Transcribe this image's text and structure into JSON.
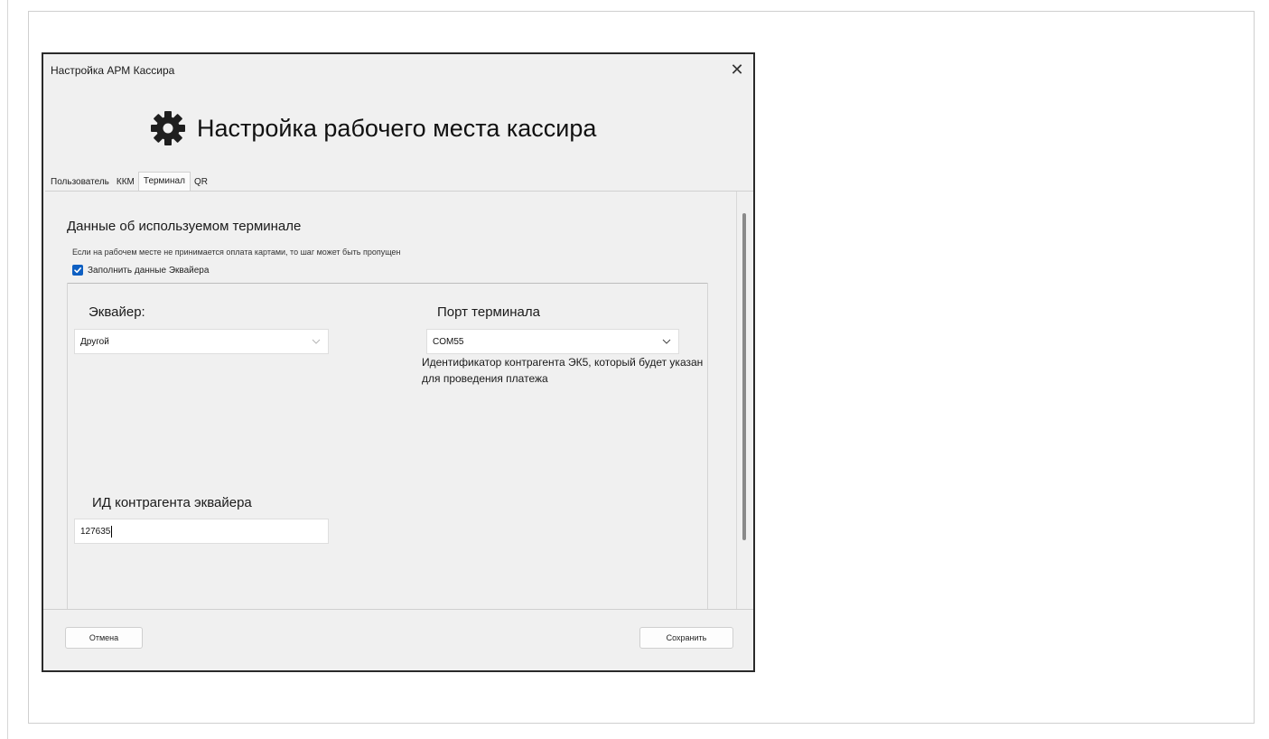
{
  "window": {
    "title": "Настройка АРМ Кассира",
    "close_glyph": "✕",
    "heading": "Настройка рабочего места кассира",
    "heading_icon": "gear-icon"
  },
  "tabs": [
    {
      "label": "Пользователь",
      "active": false
    },
    {
      "label": "ККМ",
      "active": false
    },
    {
      "label": "Терминал",
      "active": true
    },
    {
      "label": "QR",
      "active": false
    }
  ],
  "terminal": {
    "section_title": "Данные об используемом терминале",
    "hint": "Если на рабочем месте не принимается оплата картами, то шаг может быть пропущен",
    "fill_acquirer_checkbox": {
      "label": "Заполнить данные Эквайера",
      "checked": true
    },
    "acquirer": {
      "label": "Эквайер:",
      "value": "Другой"
    },
    "port": {
      "label": "Порт терминала",
      "value": "COM55"
    },
    "counterparty_id": {
      "label": "ИД контрагента эквайера",
      "value": "127635"
    },
    "counterparty_description": "Идентификатор контрагента ЭК5, который будет указан для проведения платежа"
  },
  "footer": {
    "cancel_label": "Отмена",
    "save_label": "Сохранить"
  },
  "colors": {
    "accent": "#0e5fc2",
    "window_bg": "#f0f0f0"
  }
}
